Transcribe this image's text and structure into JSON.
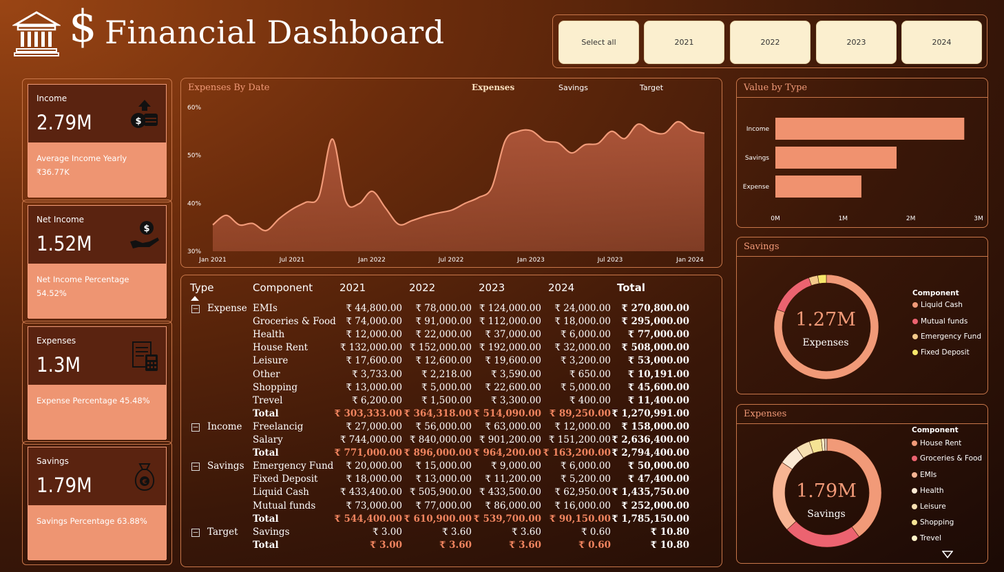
{
  "header": {
    "title": "Financial Dashboard",
    "dollar_glyph": "$",
    "slicer": [
      "Select all",
      "2021",
      "2022",
      "2023",
      "2024"
    ]
  },
  "kpis": [
    {
      "label": "Income",
      "value": "2.79M",
      "sub1": "Average Income Yearly",
      "sub2": "₹36.77K",
      "icon": "money-bag-arrow-icon"
    },
    {
      "label": "Net Income",
      "value": "1.52M",
      "sub1": "Net Income Percentage",
      "sub2": "54.52%",
      "icon": "hand-coin-icon"
    },
    {
      "label": "Expenses",
      "value": "1.3M",
      "sub1": "Expense Percentage 45.48%",
      "sub2": "",
      "icon": "invoice-calculator-icon"
    },
    {
      "label": "Savings",
      "value": "1.79M",
      "sub1": "Savings Percentage 63.88%",
      "sub2": "",
      "icon": "euro-bag-icon"
    }
  ],
  "line_chart": {
    "title": "Expenses By Date",
    "tabs": [
      "Expenses",
      "Savings",
      "Target"
    ],
    "active_tab": "Expenses",
    "colors": {
      "line": "#f19a78",
      "fill": "#b0573b"
    }
  },
  "matrix": {
    "headers": [
      "Type",
      "Component",
      "2021",
      "2022",
      "2023",
      "2024",
      "Total"
    ],
    "groups": [
      {
        "type": "Expense",
        "rows": [
          [
            "EMIs",
            "₹ 44,800.00",
            "₹ 78,000.00",
            "₹ 124,000.00",
            "₹ 24,000.00",
            "₹ 270,800.00"
          ],
          [
            "Groceries & Food",
            "₹ 74,000.00",
            "₹ 91,000.00",
            "₹ 112,000.00",
            "₹ 18,000.00",
            "₹ 295,000.00"
          ],
          [
            "Health",
            "₹ 12,000.00",
            "₹ 22,000.00",
            "₹ 37,000.00",
            "₹ 6,000.00",
            "₹ 77,000.00"
          ],
          [
            "House Rent",
            "₹ 132,000.00",
            "₹ 152,000.00",
            "₹ 192,000.00",
            "₹ 32,000.00",
            "₹ 508,000.00"
          ],
          [
            "Leisure",
            "₹ 17,600.00",
            "₹ 12,600.00",
            "₹ 19,600.00",
            "₹ 3,200.00",
            "₹ 53,000.00"
          ],
          [
            "Other",
            "₹ 3,733.00",
            "₹ 2,218.00",
            "₹ 3,590.00",
            "₹ 650.00",
            "₹ 10,191.00"
          ],
          [
            "Shopping",
            "₹ 13,000.00",
            "₹ 5,000.00",
            "₹ 22,600.00",
            "₹ 5,000.00",
            "₹ 45,600.00"
          ],
          [
            "Trevel",
            "₹ 6,200.00",
            "₹ 1,500.00",
            "₹ 3,300.00",
            "₹ 400.00",
            "₹ 11,400.00"
          ]
        ],
        "total": [
          "Total",
          "₹ 303,333.00",
          "₹ 364,318.00",
          "₹ 514,090.00",
          "₹ 89,250.00",
          "₹ 1,270,991.00"
        ]
      },
      {
        "type": "Income",
        "rows": [
          [
            "Freelancig",
            "₹ 27,000.00",
            "₹ 56,000.00",
            "₹ 63,000.00",
            "₹ 12,000.00",
            "₹ 158,000.00"
          ],
          [
            "Salary",
            "₹ 744,000.00",
            "₹ 840,000.00",
            "₹ 901,200.00",
            "₹ 151,200.00",
            "₹ 2,636,400.00"
          ]
        ],
        "total": [
          "Total",
          "₹ 771,000.00",
          "₹ 896,000.00",
          "₹ 964,200.00",
          "₹ 163,200.00",
          "₹ 2,794,400.00"
        ]
      },
      {
        "type": "Savings",
        "rows": [
          [
            "Emergency Fund",
            "₹ 20,000.00",
            "₹ 15,000.00",
            "₹ 9,000.00",
            "₹ 6,000.00",
            "₹ 50,000.00"
          ],
          [
            "Fixed Deposit",
            "₹ 18,000.00",
            "₹ 13,000.00",
            "₹ 11,200.00",
            "₹ 5,200.00",
            "₹ 47,400.00"
          ],
          [
            "Liquid Cash",
            "₹ 433,400.00",
            "₹ 505,900.00",
            "₹ 433,500.00",
            "₹ 62,950.00",
            "₹ 1,435,750.00"
          ],
          [
            "Mutual funds",
            "₹ 73,000.00",
            "₹ 77,000.00",
            "₹ 86,000.00",
            "₹ 16,000.00",
            "₹ 252,000.00"
          ]
        ],
        "total": [
          "Total",
          "₹ 544,400.00",
          "₹ 610,900.00",
          "₹ 539,700.00",
          "₹ 90,150.00",
          "₹ 1,785,150.00"
        ]
      },
      {
        "type": "Target",
        "rows": [
          [
            "Savings",
            "₹ 3.00",
            "₹ 3.60",
            "₹ 3.60",
            "₹ 0.60",
            "₹ 10.80"
          ]
        ],
        "total": [
          "Total",
          "₹ 3.00",
          "₹ 3.60",
          "₹ 3.60",
          "₹ 0.60",
          "₹ 10.80"
        ]
      }
    ]
  },
  "value_by_type": {
    "title": "Value by Type",
    "bar_color": "#f0926f"
  },
  "savings_donut": {
    "title": "Savings",
    "center_value": "1.27M",
    "center_label": "Expenses",
    "legend_title": "Component",
    "legend": [
      {
        "name": "Liquid Cash",
        "color": "#f19a78"
      },
      {
        "name": "Mutual funds",
        "color": "#ec6370"
      },
      {
        "name": "Emergency Fund",
        "color": "#f3c98a"
      },
      {
        "name": "Fixed Deposit",
        "color": "#f7e76a"
      }
    ]
  },
  "expenses_donut": {
    "title": "Expenses",
    "center_value": "1.79M",
    "center_label": "Savings",
    "legend_title": "Component",
    "legend": [
      {
        "name": "House Rent",
        "color": "#f19a78"
      },
      {
        "name": "Groceries & Food",
        "color": "#ec6370"
      },
      {
        "name": "EMIs",
        "color": "#f7b493"
      },
      {
        "name": "Health",
        "color": "#fbe9d4"
      },
      {
        "name": "Leisure",
        "color": "#f6dfb1"
      },
      {
        "name": "Shopping",
        "color": "#f5e394"
      },
      {
        "name": "Trevel",
        "color": "#fff3c8"
      }
    ]
  },
  "chart_data": [
    {
      "type": "area",
      "title": "Expenses By Date",
      "x": [
        "2021-01",
        "2021-02",
        "2021-03",
        "2021-04",
        "2021-05",
        "2021-06",
        "2021-07",
        "2021-08",
        "2021-09",
        "2021-10",
        "2021-11",
        "2021-12",
        "2022-01",
        "2022-02",
        "2022-03",
        "2022-04",
        "2022-05",
        "2022-06",
        "2022-07",
        "2022-08",
        "2022-09",
        "2022-10",
        "2022-11",
        "2022-12",
        "2023-01",
        "2023-02",
        "2023-03",
        "2023-04",
        "2023-05",
        "2023-06",
        "2023-07",
        "2023-08",
        "2023-09",
        "2023-10",
        "2023-11",
        "2023-12",
        "2024-01",
        "2024-02"
      ],
      "y": [
        35.5,
        37.5,
        35.5,
        35.8,
        34.3,
        36.8,
        38.8,
        40.2,
        41.5,
        53.4,
        40.5,
        39.9,
        42.5,
        39.0,
        35.6,
        36.4,
        37.3,
        38.0,
        38.6,
        40.0,
        41.2,
        43.3,
        53.0,
        55.0,
        55.1,
        53.0,
        52.6,
        50.5,
        52.2,
        52.5,
        55.0,
        53.5,
        56.5,
        55.0,
        54.6,
        57.0,
        55.2,
        54.6
      ],
      "x_ticks": [
        "Jan 2021",
        "Jul 2021",
        "Jan 2022",
        "Jul 2022",
        "Jan 2023",
        "Jul 2023",
        "Jan 2024"
      ],
      "y_ticks": [
        "30%",
        "40%",
        "50%",
        "60%"
      ],
      "ylim": [
        30,
        60
      ],
      "grid": false
    },
    {
      "type": "bar",
      "title": "Value by Type",
      "categories": [
        "Income",
        "Savings",
        "Expense"
      ],
      "values": [
        2.79,
        1.79,
        1.27
      ],
      "x_ticks": [
        "0M",
        "1M",
        "2M",
        "3M"
      ],
      "xlim": [
        0,
        3
      ]
    },
    {
      "type": "pie",
      "title": "Savings",
      "categories": [
        "Liquid Cash",
        "Mutual funds",
        "Emergency Fund",
        "Fixed Deposit"
      ],
      "values": [
        1435750,
        252000,
        50000,
        47400
      ]
    },
    {
      "type": "pie",
      "title": "Expenses",
      "categories": [
        "House Rent",
        "Groceries & Food",
        "EMIs",
        "Health",
        "Leisure",
        "Shopping",
        "Trevel",
        "Other"
      ],
      "values": [
        508000,
        295000,
        270800,
        77000,
        53000,
        45600,
        11400,
        10191
      ]
    }
  ]
}
